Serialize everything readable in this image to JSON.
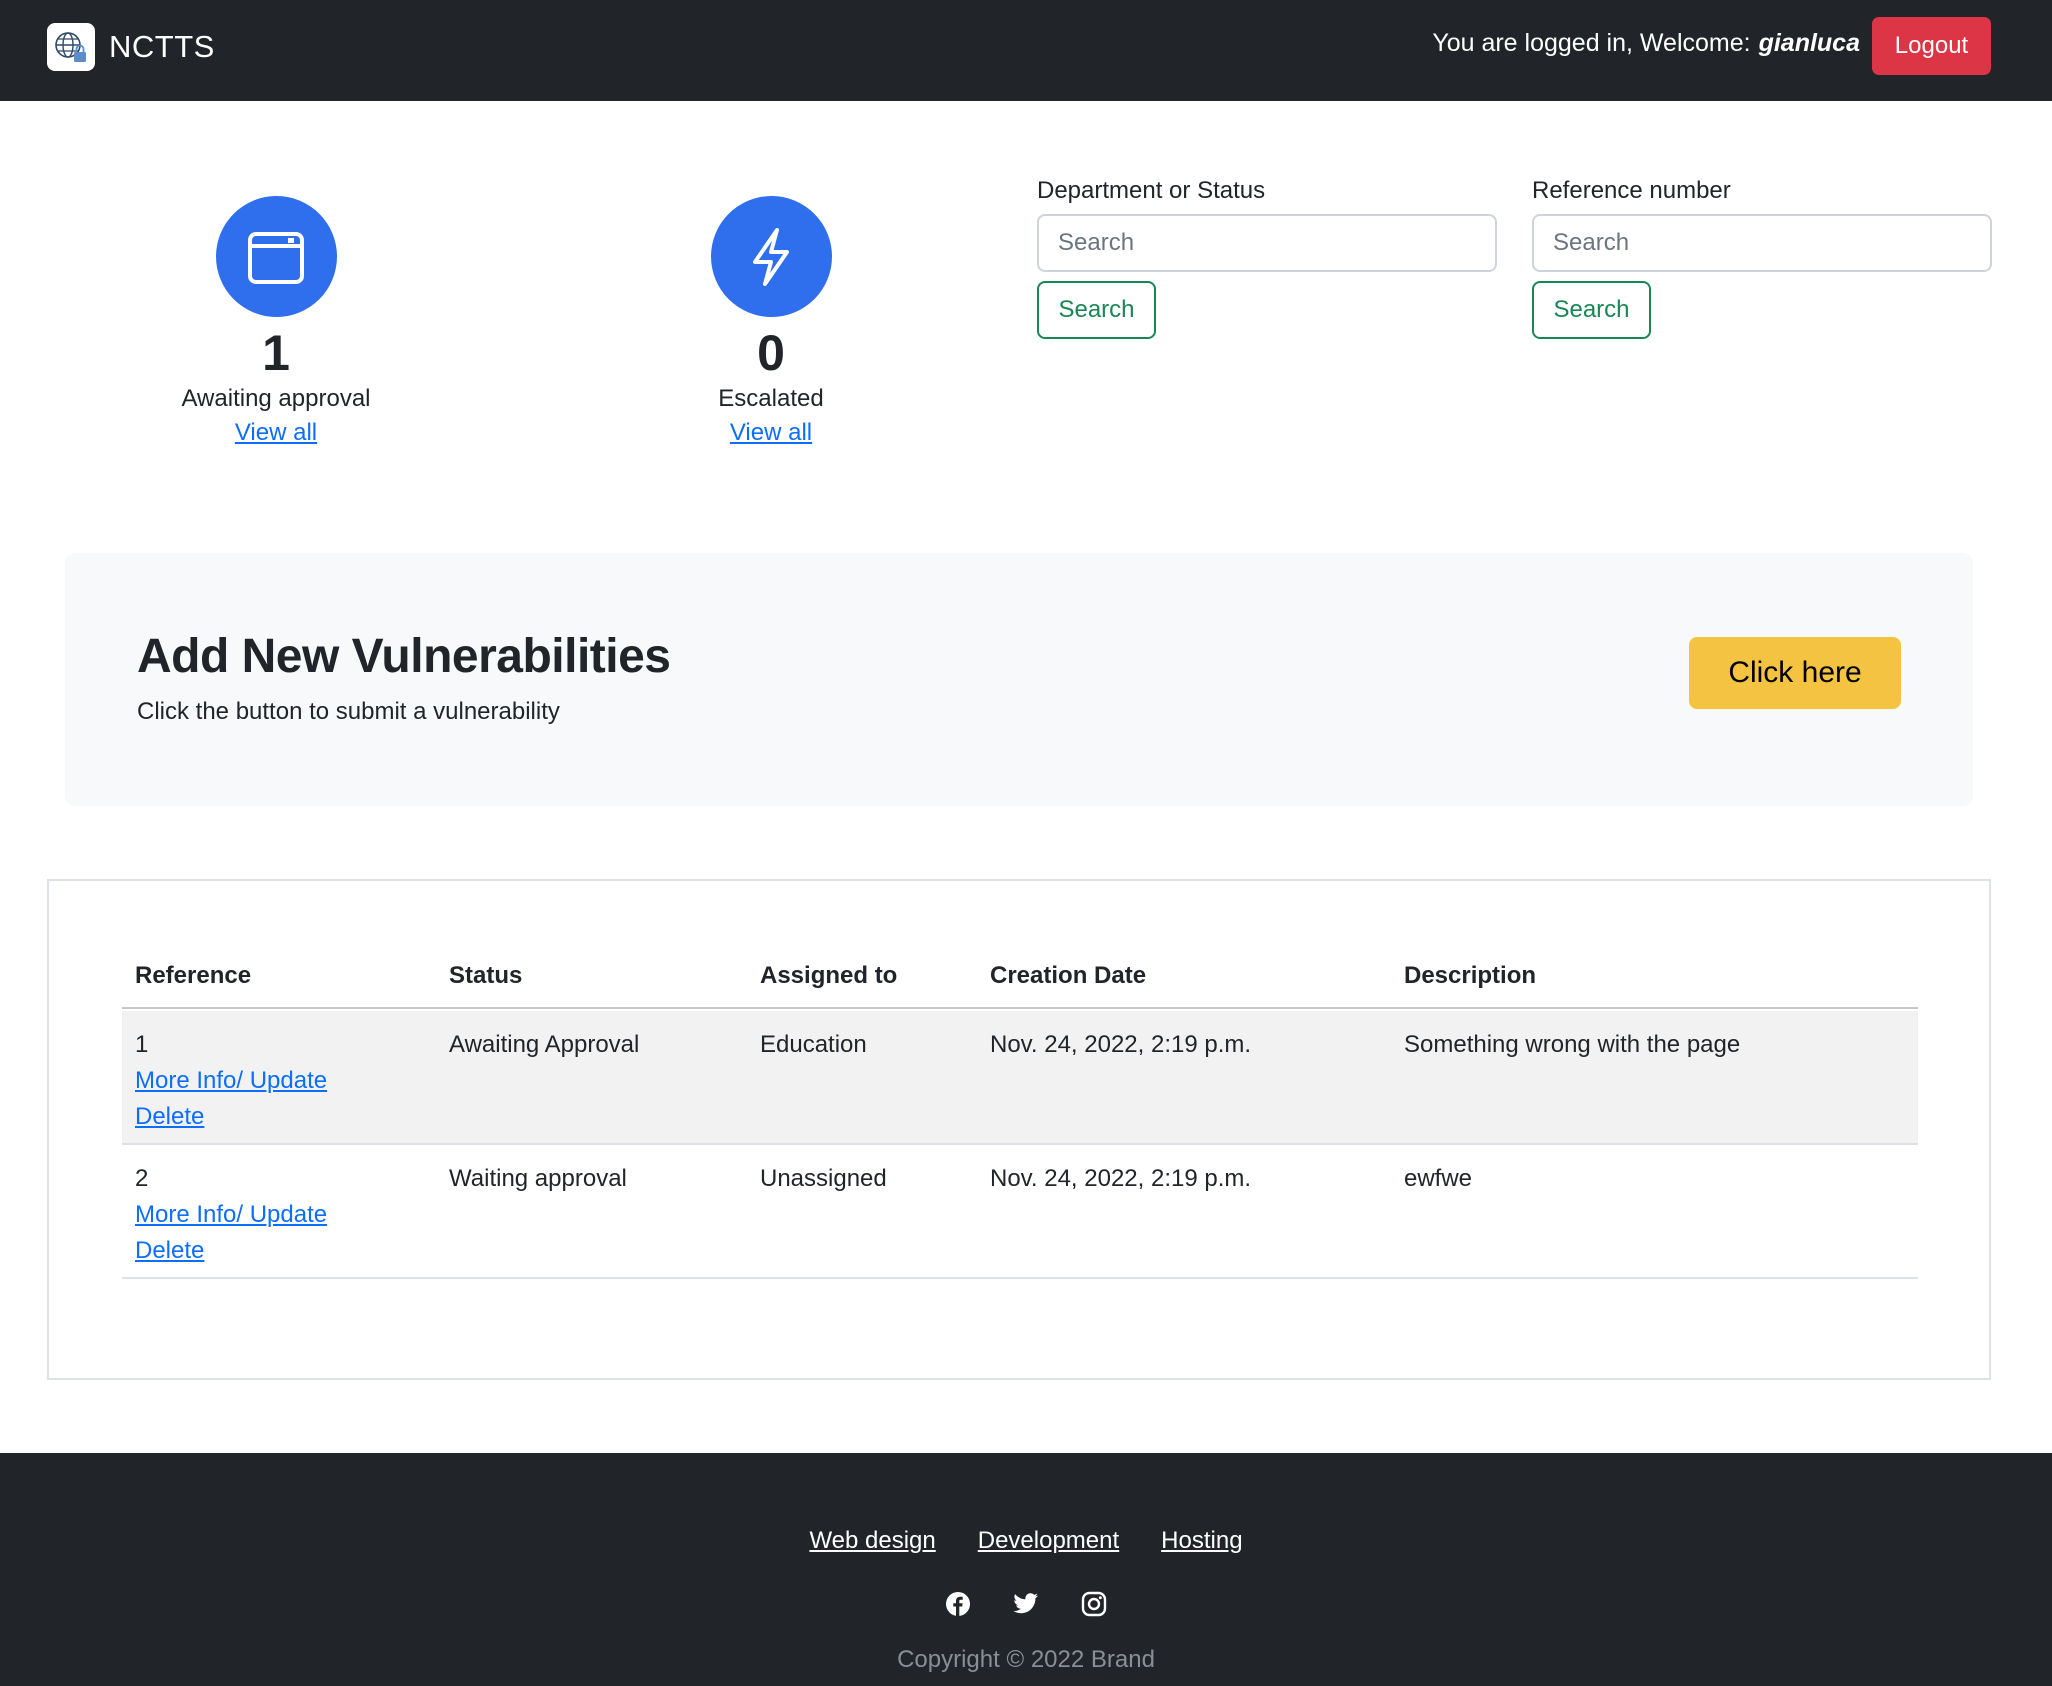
{
  "app": {
    "brand": "NCTTS",
    "welcome_text": "You are logged in, Welcome:",
    "username": "gianluca",
    "logout_label": "Logout"
  },
  "stats": [
    {
      "icon": "calendar-icon",
      "count": "1",
      "label": "Awaiting approval",
      "link": "View all"
    },
    {
      "icon": "lightning-icon",
      "count": "0",
      "label": "Escalated",
      "link": "View all"
    }
  ],
  "search": {
    "department": {
      "label": "Department or Status",
      "placeholder": "Search",
      "button": "Search"
    },
    "reference": {
      "label": "Reference number",
      "placeholder": "Search",
      "button": "Search"
    }
  },
  "cta": {
    "title": "Add New Vulnerabilities",
    "subtitle": "Click the button to submit a vulnerability",
    "button": "Click here"
  },
  "table": {
    "columns": [
      "Reference",
      "Status",
      "Assigned to",
      "Creation Date",
      "Description"
    ],
    "rows": [
      {
        "reference": "1",
        "more_info": "More Info/ Update",
        "delete": "Delete",
        "status": "Awaiting Approval",
        "assigned": "Education",
        "date": "Nov. 24, 2022, 2:19 p.m.",
        "description": "Something wrong with the page"
      },
      {
        "reference": "2",
        "more_info": "More Info/ Update",
        "delete": "Delete",
        "status": "Waiting approval",
        "assigned": "Unassigned",
        "date": "Nov. 24, 2022, 2:19 p.m.",
        "description": "ewfwe"
      }
    ]
  },
  "footer": {
    "links": [
      "Web design",
      "Development",
      "Hosting"
    ],
    "social": [
      "facebook-icon",
      "twitter-icon",
      "instagram-icon"
    ],
    "copyright": "Copyright © 2022 Brand"
  },
  "colors": {
    "navbar": "#212529",
    "logout": "#dc3545",
    "stat_circle": "#2f6fed",
    "search_button": "#198754",
    "cta_button": "#f5c342",
    "link": "#0d6efd"
  }
}
